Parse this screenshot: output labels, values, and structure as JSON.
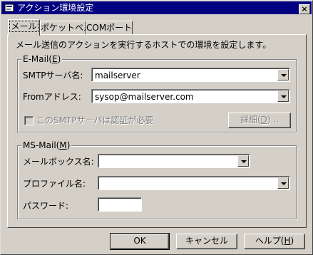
{
  "window": {
    "title": "アクション環境設定",
    "close_glyph": "×"
  },
  "tabs": [
    {
      "label": "メール",
      "active": true
    },
    {
      "label": "ポケットベル",
      "active": false
    },
    {
      "label": "COMポート",
      "active": false
    }
  ],
  "mail_tab": {
    "description": "メール送信のアクションを実行するホストでの環境を設定します。",
    "email_group": {
      "legend_prefix": "E-Mail(",
      "legend_key": "E",
      "legend_suffix": ")",
      "smtp_label": "SMTPサーバ名:",
      "smtp_value": "mailserver",
      "from_label": "Fromアドレス:",
      "from_value": "sysop@mailserver.com",
      "auth_checkbox_label": "このSMTPサーバは認証が必要",
      "auth_checked": false,
      "details_prefix": "詳細(",
      "details_key": "D",
      "details_suffix": ")..."
    },
    "msmail_group": {
      "legend_prefix": "MS-Mail(",
      "legend_key": "M",
      "legend_suffix": ")",
      "mailbox_label": "メールボックス名:",
      "mailbox_value": "",
      "profile_label": "プロファイル名:",
      "profile_value": "",
      "password_label": "パスワード:",
      "password_value": ""
    }
  },
  "buttons": {
    "ok": "OK",
    "cancel": "キャンセル",
    "help_prefix": "ヘルプ(",
    "help_key": "H",
    "help_suffix": ")"
  }
}
